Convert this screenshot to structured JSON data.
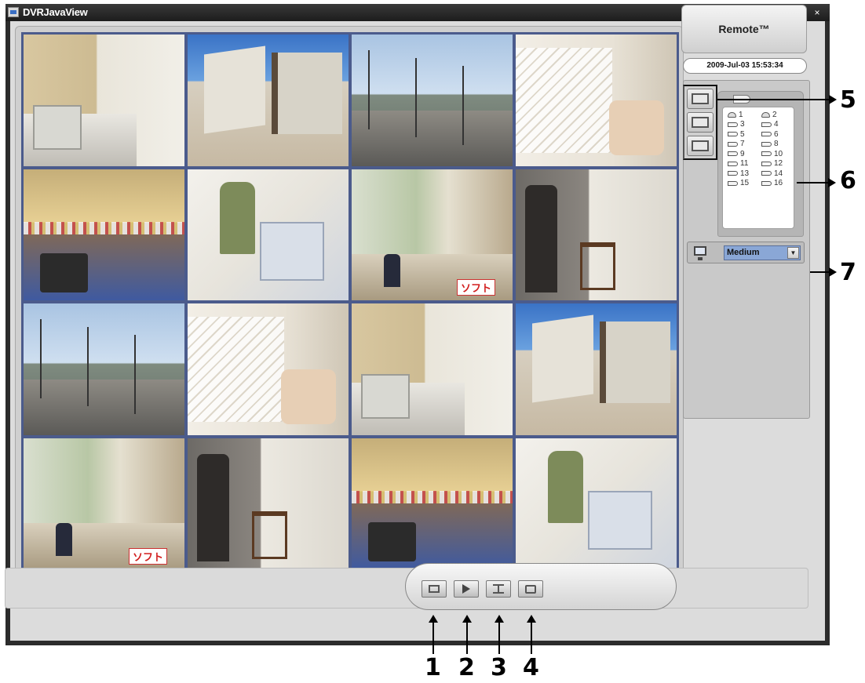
{
  "window": {
    "title": "DVRJavaView",
    "minimize_label": "▁",
    "maximize_label": "▣",
    "close_label": "×"
  },
  "cameras": {
    "scenes": [
      "office",
      "house",
      "street",
      "stair",
      "mall",
      "shop",
      "arcade",
      "waiting",
      "street",
      "stair",
      "office",
      "house",
      "arcade",
      "waiting",
      "mall",
      "shop"
    ],
    "sign_text": "ソフト"
  },
  "sidebar": {
    "remote_label": "Remote™",
    "datetime": "2009-Jul-03 15:53:34",
    "layouts": [
      {
        "name": "quad",
        "icon": "grid-4-icon"
      },
      {
        "name": "nine",
        "icon": "grid-9-icon"
      },
      {
        "name": "sixteen",
        "icon": "grid-16-icon"
      }
    ],
    "camera_list": [
      {
        "left": "1",
        "right": "2",
        "left_icon": "dome-camera-icon",
        "right_icon": "dome-camera-icon"
      },
      {
        "left": "3",
        "right": "4",
        "left_icon": "camera-icon",
        "right_icon": "camera-icon"
      },
      {
        "left": "5",
        "right": "6",
        "left_icon": "camera-icon",
        "right_icon": "camera-icon"
      },
      {
        "left": "7",
        "right": "8",
        "left_icon": "camera-icon",
        "right_icon": "camera-icon"
      },
      {
        "left": "9",
        "right": "10",
        "left_icon": "camera-icon",
        "right_icon": "camera-icon"
      },
      {
        "left": "11",
        "right": "12",
        "left_icon": "camera-icon",
        "right_icon": "camera-icon"
      },
      {
        "left": "13",
        "right": "14",
        "left_icon": "camera-icon",
        "right_icon": "camera-icon"
      },
      {
        "left": "15",
        "right": "16",
        "left_icon": "camera-icon",
        "right_icon": "camera-icon"
      }
    ],
    "quality": {
      "selected": "Medium",
      "icon": "monitor-icon"
    }
  },
  "toolbar": {
    "buttons": [
      {
        "name": "live-view-button",
        "icon": "live-icon"
      },
      {
        "name": "playback-button",
        "icon": "play-icon"
      },
      {
        "name": "network-button",
        "icon": "network-icon"
      },
      {
        "name": "search-button",
        "icon": "search-icon"
      }
    ]
  },
  "callouts": {
    "c1": "1",
    "c2": "2",
    "c3": "3",
    "c4": "4",
    "c5": "5",
    "c6": "6",
    "c7": "7"
  }
}
